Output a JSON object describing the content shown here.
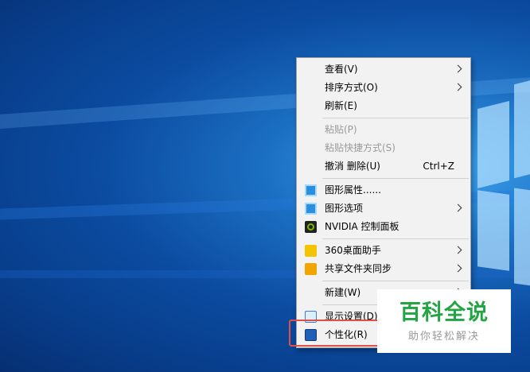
{
  "context_menu": {
    "items": [
      {
        "label": "查看(V)",
        "has_submenu": true
      },
      {
        "label": "排序方式(O)",
        "has_submenu": true
      },
      {
        "label": "刷新(E)"
      },
      {
        "label": "粘贴(P)",
        "disabled": true
      },
      {
        "label": "粘贴快捷方式(S)",
        "disabled": true
      },
      {
        "label": "撤消 删除(U)",
        "shortcut": "Ctrl+Z"
      },
      {
        "label": "图形属性......",
        "icon": "graphics-properties-icon"
      },
      {
        "label": "图形选项",
        "icon": "graphics-options-icon",
        "has_submenu": true
      },
      {
        "label": "NVIDIA 控制面板",
        "icon": "nvidia-icon"
      },
      {
        "label": "360桌面助手",
        "icon": "360-icon",
        "has_submenu": true
      },
      {
        "label": "共享文件夹同步",
        "icon": "share-sync-icon",
        "has_submenu": true
      },
      {
        "label": "新建(W)",
        "has_submenu": true
      },
      {
        "label": "显示设置(D)",
        "icon": "display-icon"
      },
      {
        "label": "个性化(R)",
        "icon": "personalize-icon"
      }
    ]
  },
  "watermark": {
    "title": "百科全说",
    "subtitle": "助你轻松解决"
  },
  "colors": {
    "highlight_border": "#e0504a",
    "watermark_green": "#22a542",
    "menu_background": "#f2f2f2"
  }
}
